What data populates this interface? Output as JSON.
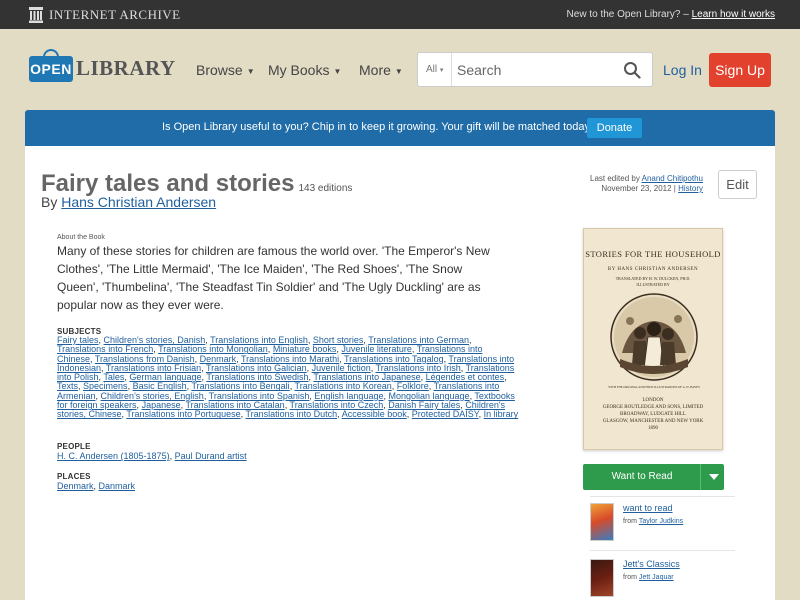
{
  "topbar": {
    "brand": "INTERNET ARCHIVE",
    "notice": "New to the Open Library?",
    "link": "Learn how it works"
  },
  "header": {
    "logo_open": "OPEN",
    "logo_library": "LIBRARY",
    "nav": [
      "Browse",
      "My Books",
      "More"
    ],
    "search_scope": "All",
    "search_placeholder": "Search",
    "login": "Log In",
    "signup": "Sign Up"
  },
  "donate_bar": {
    "text": "Is Open Library useful to you? Chip in to keep it growing. Your gift will be matched today!",
    "button": "Donate"
  },
  "work": {
    "title": "Fairy tales and stories",
    "editions": "143 editions",
    "by": "By",
    "author": "Hans Christian Andersen",
    "last_edited_prefix": "Last edited by",
    "last_edited_by": "Anand Chitipothu",
    "last_edited_date": "November 23, 2012",
    "history": "History",
    "edit": "Edit",
    "about_label": "About the Book",
    "description": "Many of these stories for children are famous the world over. 'The Emperor's New Clothes', 'The Little Mermaid', 'The Ice Maiden', 'The Red Shoes', 'The Snow Queen', 'Thumbelina', 'The Steadfast Tin Soldier' and 'The Ugly Duckling' are as popular now as they ever were.",
    "subjects_label": "SUBJECTS",
    "subjects": [
      "Fairy tales",
      "Children's stories, Danish",
      "Translations into English",
      "Short stories",
      "Translations into German",
      "Translations into French",
      "Translations into Mongolian",
      "Miniature books",
      "Juvenile literature",
      "Translations into Chinese",
      "Translations from Danish",
      "Denmark",
      "Translations into Marathi",
      "Translations into Tagalog",
      "Translations into Indonesian",
      "Translations into Frisian",
      "Translations into Galician",
      "Juvenile fiction",
      "Translations into Irish",
      "Translations into Polish",
      "Tales",
      "German language",
      "Translations into Swedish",
      "Translations into Japanese",
      "Légendes et contes",
      "Texts",
      "Specimens",
      "Basic English",
      "Translations into Bengali",
      "Translations into Korean",
      "Folklore",
      "Translations into Armenian",
      "Children's stories, English",
      "Translations into Spanish",
      "English language",
      "Mongolian language",
      "Textbooks for foreign speakers",
      "Japanese",
      "Translations into Catalan",
      "Translations into Czech",
      "Danish Fairy tales",
      "Children's stories, Chinese",
      "Translations into Portuguese",
      "Translations into Dutch",
      "Accessible book",
      "Protected DAISY",
      "In library"
    ],
    "people_label": "PEOPLE",
    "people": [
      "H. C. Andersen (1805-1875)",
      "Paul Durand artist"
    ],
    "places_label": "PLACES",
    "places": [
      "Denmark",
      "Danmark"
    ]
  },
  "cover": {
    "title": "STORIES FOR THE HOUSEHOLD",
    "author": "BY HANS CHRISTIAN ANDERSEN",
    "translated": "TRANSLATED BY H. W. DULCKEN, PH.D.",
    "illustrated": "ILLUSTRATED BY",
    "caption": "WITH THE ORIGINAL AND FIRST ILLUSTRATIONS OF A. W. BAYES",
    "pub_city": "LONDON",
    "publisher": "GEORGE ROUTLEDGE AND SONS, LIMITED",
    "pub_line2": "BROADWAY, LUDGATE HILL",
    "pub_line3": "GLASGOW, MANCHESTER AND NEW YORK",
    "pub_year": "1890"
  },
  "sidebar": {
    "want_to_read": "Want to Read",
    "lists": [
      {
        "name": "want to read",
        "from_prefix": "from",
        "from": "Taylor Judkins",
        "thumb_color": "#d84b2a"
      },
      {
        "name": "Jett's Classics",
        "from_prefix": "from",
        "from": "Jett Jaquar",
        "thumb_color": "#6b1f12"
      }
    ]
  }
}
